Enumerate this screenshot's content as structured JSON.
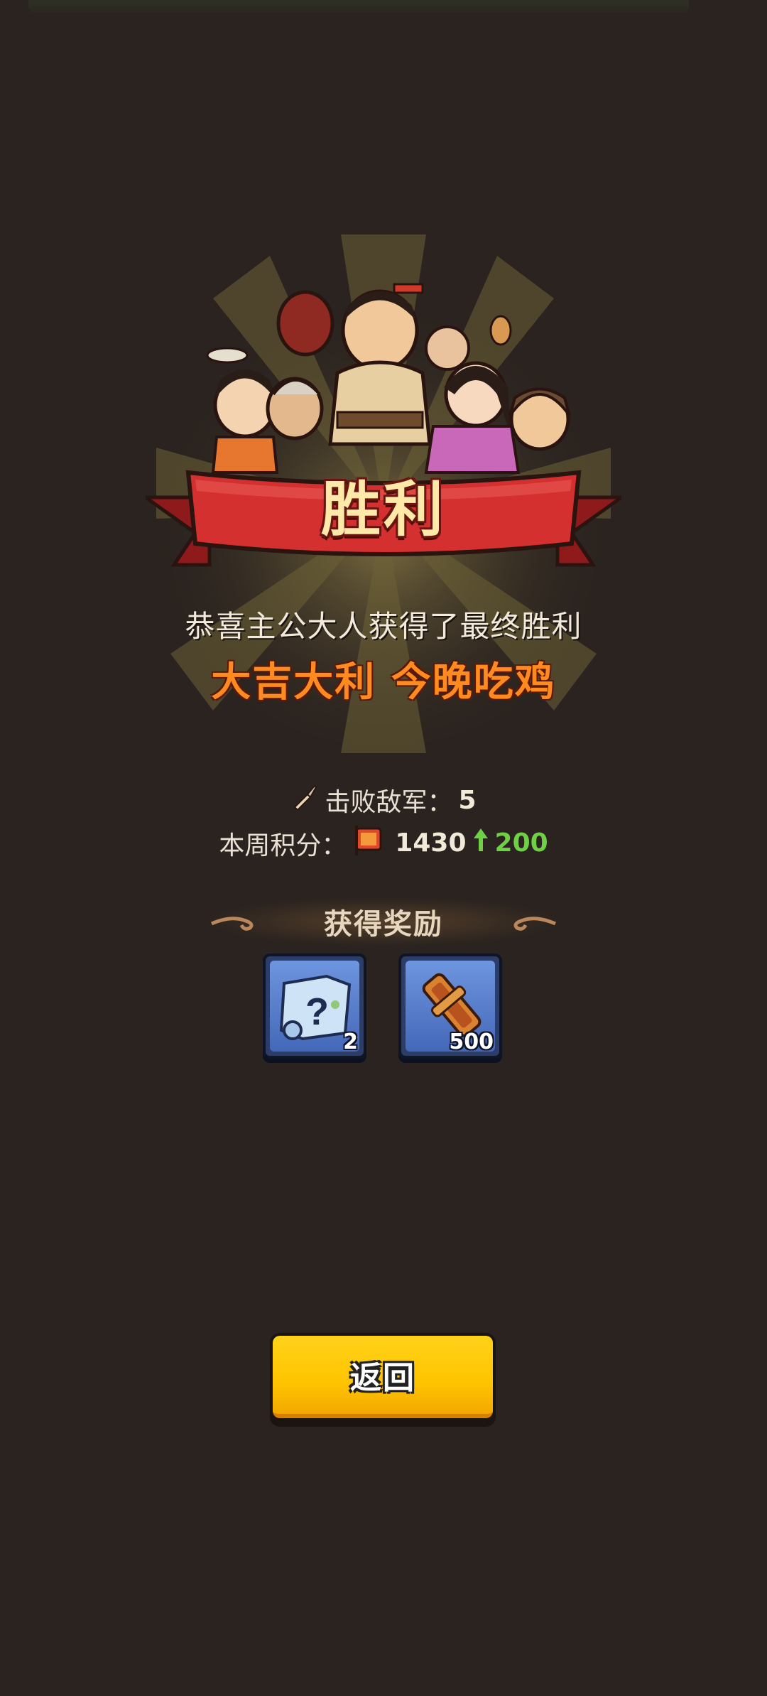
{
  "banner": {
    "title": "胜利"
  },
  "message": {
    "subtitle": "恭喜主公大人获得了最终胜利",
    "slogan": "大吉大利 今晚吃鸡"
  },
  "stats": {
    "defeated_label": "击败敌军：",
    "defeated_value": "5",
    "weekly_label": "本周积分：",
    "weekly_points": "1430",
    "weekly_gain": "200"
  },
  "rewards": {
    "title": "获得奖励",
    "items": [
      {
        "icon": "mystery-map-icon",
        "count": "2"
      },
      {
        "icon": "bronze-token-icon",
        "count": "500"
      }
    ]
  },
  "buttons": {
    "return_label": "返回"
  },
  "colors": {
    "background": "#2a231f",
    "banner_red": "#c8262a",
    "slogan_orange": "#ff8a1f",
    "gain_green": "#6fcf45",
    "button_yellow": "#ffc400",
    "tile_blue": "#4468b8"
  }
}
